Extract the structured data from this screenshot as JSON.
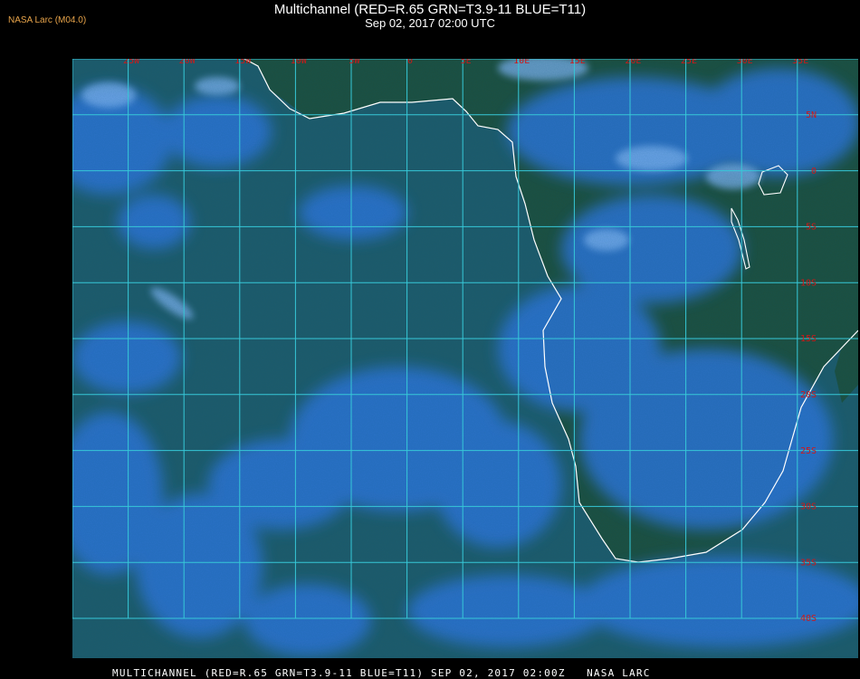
{
  "header": {
    "credit": "NASA Larc (M04.0)",
    "title": "Multichannel (RED=R.65 GRN=T3.9-11 BLUE=T11)",
    "subtitle": "Sep 02, 2017 02:00 UTC"
  },
  "map": {
    "longitude_labels": [
      "25W",
      "20W",
      "15W",
      "10W",
      "5W",
      "0",
      "5E",
      "10E",
      "15E",
      "20E",
      "25E",
      "30E",
      "35E"
    ],
    "latitude_labels": [
      "5N",
      "0",
      "5S",
      "10S",
      "15S",
      "20S",
      "25S",
      "30S",
      "35S",
      "40S"
    ],
    "colors": {
      "ocean": "#1f5b6a",
      "land": "#1e4f3e",
      "cloud": "#2f74d8",
      "grid": "#36c8d8",
      "coast": "#ffffff",
      "label": "#d01818"
    }
  },
  "footer": {
    "caption": "MULTICHANNEL (RED=R.65 GRN=T3.9-11 BLUE=T11) SEP 02, 2017 02:00Z   NASA LARC"
  }
}
